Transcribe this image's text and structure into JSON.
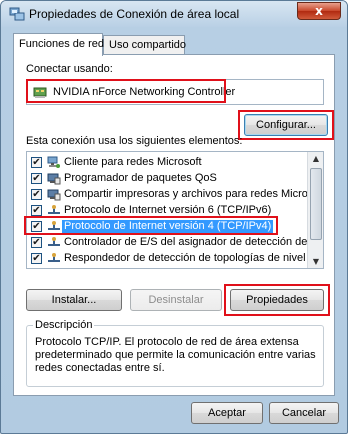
{
  "window": {
    "title": "Propiedades de Conexión de área local",
    "close_glyph": "x"
  },
  "tabs": [
    {
      "label": "Funciones de red",
      "active": true
    },
    {
      "label": "Uso compartido",
      "active": false
    }
  ],
  "connect": {
    "label": "Conectar usando:",
    "adapter": "NVIDIA nForce Networking Controller",
    "adapter_icon": "network-adapter-icon",
    "configure_button": "Configurar..."
  },
  "components": {
    "label": "Esta conexión usa los siguientes elementos:",
    "items": [
      {
        "label": "Cliente para redes Microsoft",
        "checked": true,
        "icon": "network-client-icon",
        "selected": false
      },
      {
        "label": "Programador de paquetes QoS",
        "checked": true,
        "icon": "network-service-icon",
        "selected": false
      },
      {
        "label": "Compartir impresoras y archivos para redes Microsoft",
        "checked": true,
        "icon": "network-service-icon",
        "selected": false
      },
      {
        "label": "Protocolo de Internet versión 6 (TCP/IPv6)",
        "checked": true,
        "icon": "protocol-icon",
        "selected": false
      },
      {
        "label": "Protocolo de Internet versión 4 (TCP/IPv4)",
        "checked": true,
        "icon": "protocol-icon",
        "selected": true
      },
      {
        "label": "Controlador de E/S del asignador de detección de topol...",
        "checked": true,
        "icon": "protocol-icon",
        "selected": false
      },
      {
        "label": "Respondedor de detección de topologías de nivel de v...",
        "checked": true,
        "icon": "protocol-icon",
        "selected": false
      }
    ],
    "check_glyph": "✔"
  },
  "buttons": {
    "install": "Instalar...",
    "uninstall": "Desinstalar",
    "properties": "Propiedades",
    "ok": "Aceptar",
    "cancel": "Cancelar"
  },
  "description": {
    "title": "Descripción",
    "text": "Protocolo TCP/IP. El protocolo de red de área extensa predeterminado que permite la comunicación entre varias redes conectadas entre sí."
  },
  "colors": {
    "highlight_box": "#e0101a",
    "selection": "#3399ff"
  }
}
